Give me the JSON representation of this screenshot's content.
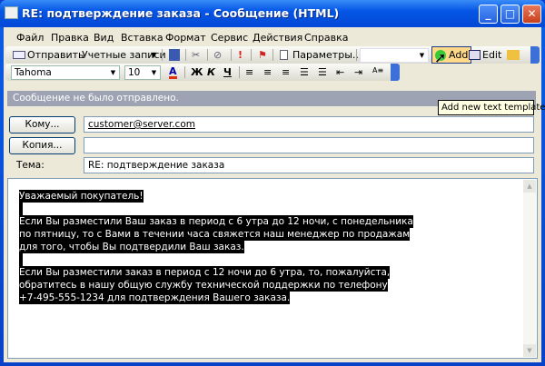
{
  "window": {
    "title": "RE: подтверждение заказа - Сообщение (HTML)",
    "minimize": "_",
    "maximize": "□",
    "close": "✕"
  },
  "menu": [
    "Файл",
    "Правка",
    "Вид",
    "Вставка",
    "Формат",
    "Сервис",
    "Действия",
    "Справка"
  ],
  "toolbar1": {
    "send": "Отправить",
    "accounts": "Учетные записи",
    "options": "Параметры...",
    "add": "Add",
    "edit": "Edit",
    "tooltip": "Add new text template"
  },
  "toolbar2": {
    "font": "Tahoma",
    "size": "10",
    "bold": "Ж",
    "italic": "К",
    "underline": "Ч"
  },
  "info": "Сообщение не было отправлено.",
  "fields": {
    "to_label": "Кому...",
    "to_value": "customer@server.com",
    "cc_label": "Копия...",
    "cc_value": "",
    "subject_label": "Тема:",
    "subject_value": "RE: подтверждение заказа"
  },
  "body_lines": [
    "Уважаемый покупатель!",
    "",
    "Если Вы разместили Ваш заказ в период с 6 утра до 12 ночи, с понедельника",
    "по пятницу, то с Вами в течении часа свяжется наш менеджер по продажам",
    "для того, чтобы Вы подтвердили Ваш заказ.",
    "",
    "Если Вы разместили заказ в период с 12 ночи до 6 утра, то, пожалуйста,",
    "обратитесь в нашу общую службу технической поддержки по телефону",
    "+7-495-555-1234 для подтверждения Вашего заказа."
  ]
}
